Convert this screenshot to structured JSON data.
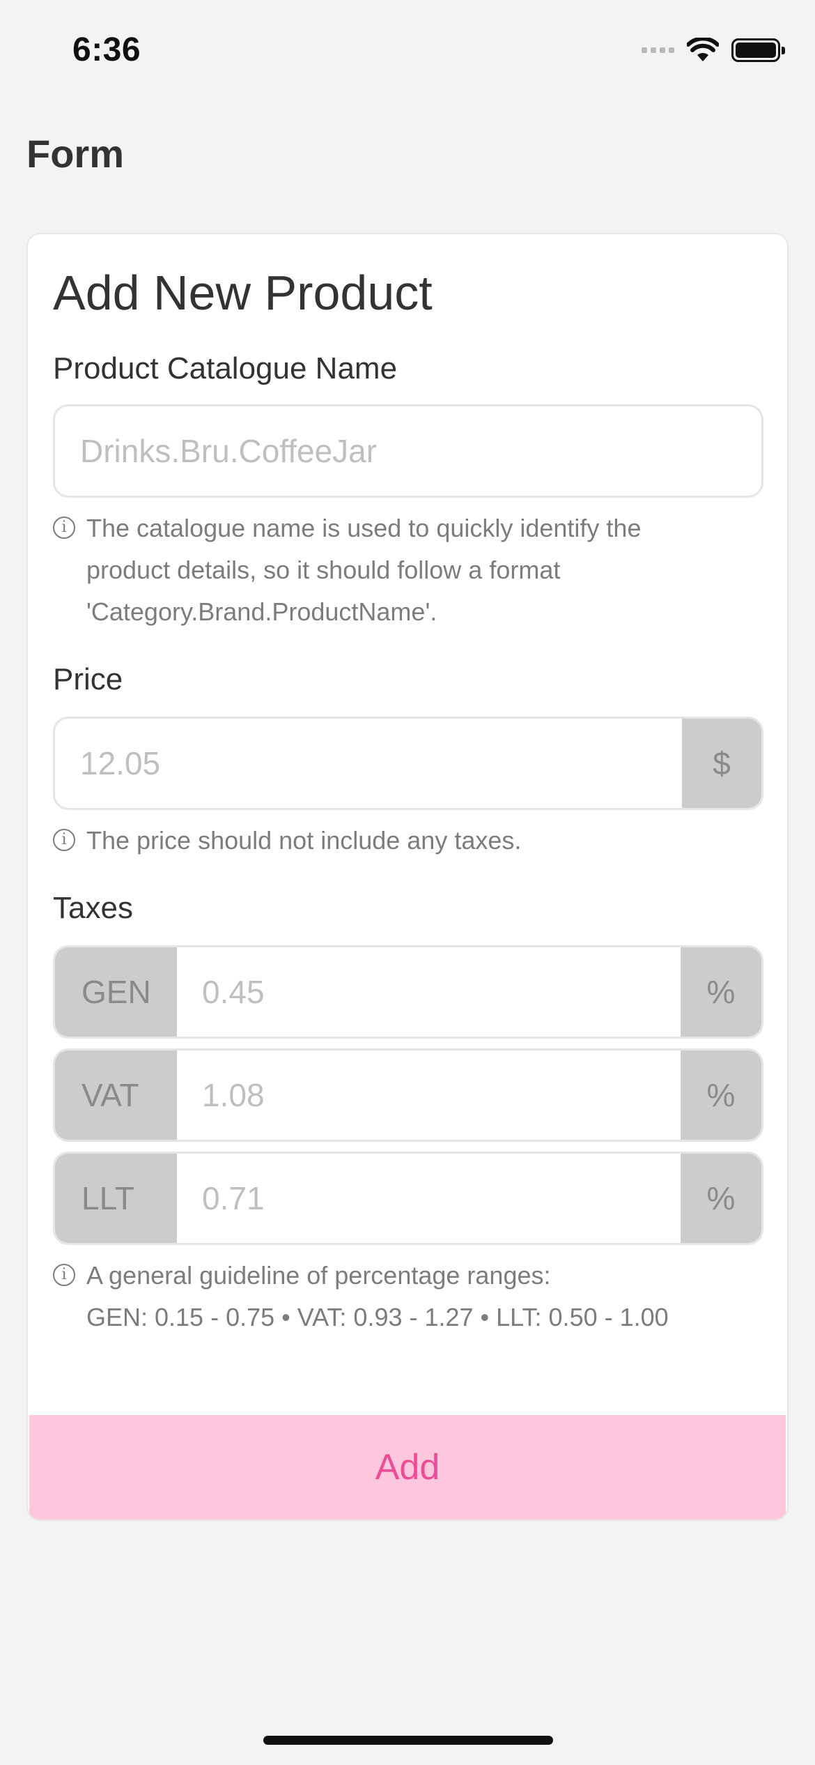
{
  "status_bar": {
    "time": "6:36"
  },
  "nav": {
    "title": "Form"
  },
  "form": {
    "title": "Add New Product",
    "catalogue": {
      "label": "Product Catalogue Name",
      "placeholder": "Drinks.Bru.CoffeeJar",
      "hint_lines": [
        "The catalogue name is used to quickly identify the",
        "product details, so it should follow a format",
        "'Category.Brand.ProductName'."
      ]
    },
    "price": {
      "label": "Price",
      "placeholder": "12.05",
      "suffix": "$",
      "hint": "The price should not include any taxes."
    },
    "taxes": {
      "label": "Taxes",
      "rows": [
        {
          "prefix": "GEN",
          "placeholder": "0.45",
          "suffix": "%"
        },
        {
          "prefix": "VAT",
          "placeholder": "1.08",
          "suffix": "%"
        },
        {
          "prefix": "LLT",
          "placeholder": "0.71",
          "suffix": "%"
        }
      ],
      "hint_lines": [
        "A general guideline of percentage ranges:",
        "GEN: 0.15 - 0.75 • VAT: 0.93 - 1.27 • LLT: 0.50 - 1.00"
      ]
    },
    "add_label": "Add"
  },
  "icons": {
    "info": "info-icon",
    "wifi": "wifi-icon",
    "battery": "battery-icon",
    "signal": "cellular-signal-icon"
  },
  "colors": {
    "accent": "#ec4c97",
    "button_bg": "#fdc7dd",
    "addon_bg": "#cccccc",
    "background": "#f3f3f3"
  }
}
